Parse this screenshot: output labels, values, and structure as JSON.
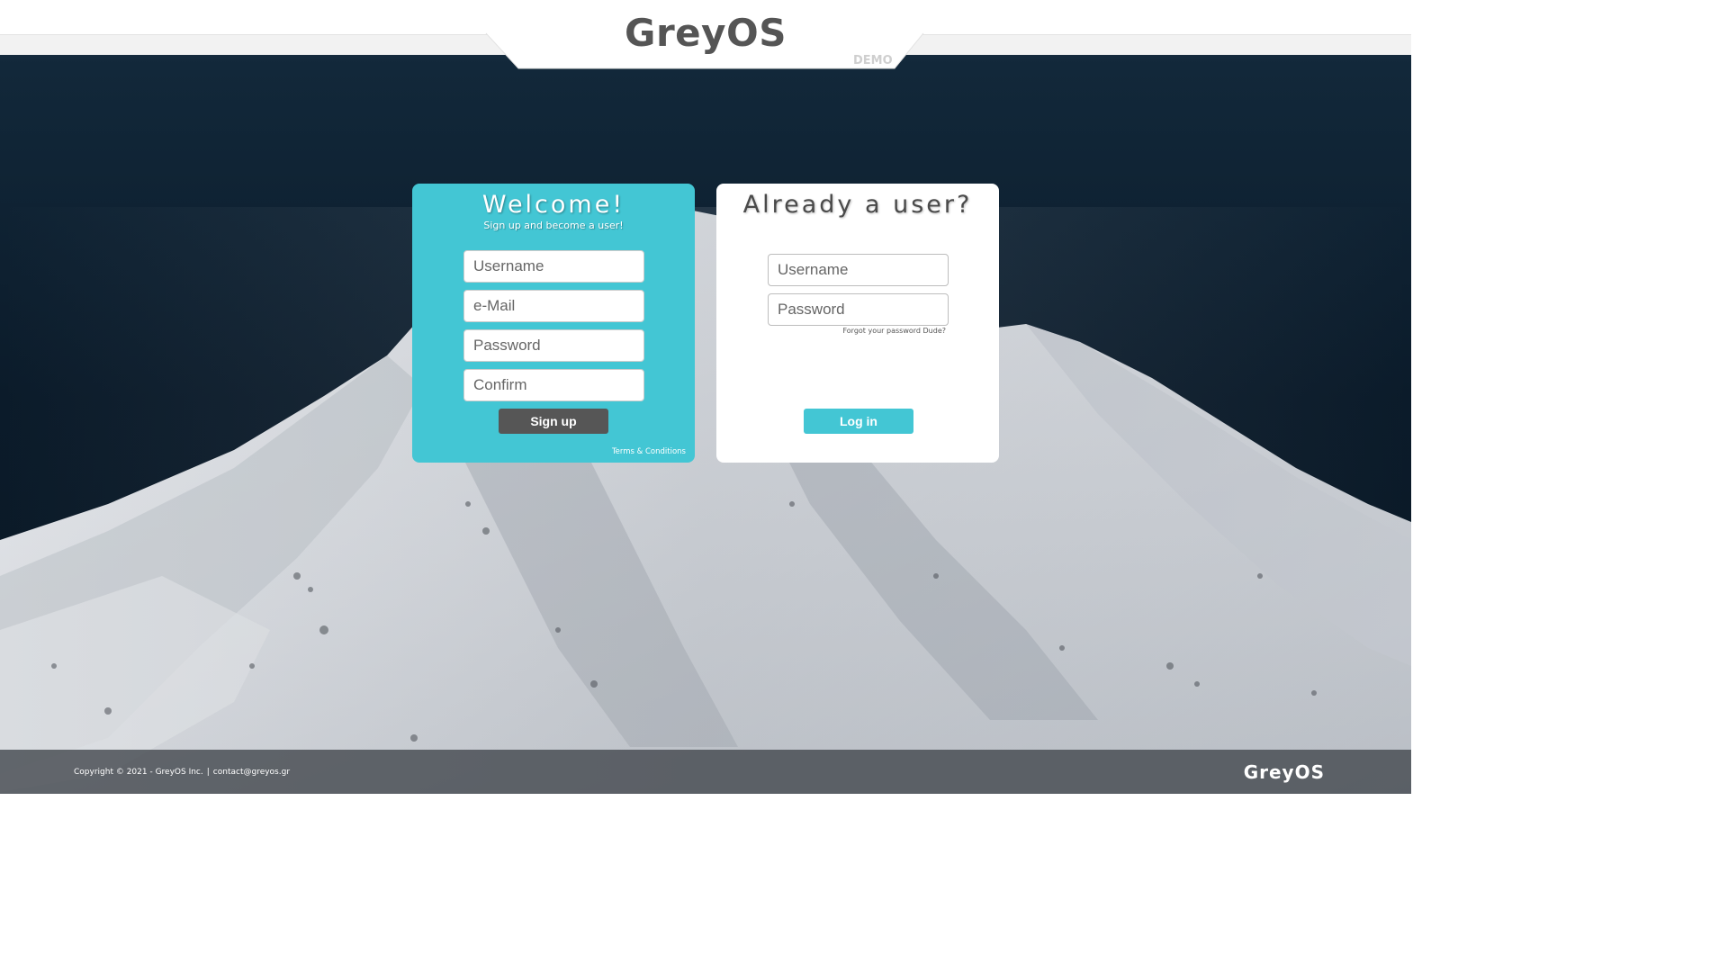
{
  "header": {
    "brand": "GreyOS",
    "tag": "DEMO"
  },
  "signup": {
    "title": "Welcome!",
    "subtitle": "Sign up and become a user!",
    "username_placeholder": "Username",
    "email_placeholder": "e-Mail",
    "password_placeholder": "Password",
    "confirm_placeholder": "Confirm",
    "button_label": "Sign up",
    "terms_label": "Terms & Conditions"
  },
  "login": {
    "title": "Already a user?",
    "username_placeholder": "Username",
    "password_placeholder": "Password",
    "forgot_label": "Forgot your password Dude?",
    "button_label": "Log in"
  },
  "footer": {
    "copyright": "Copyright © 2021 - GreyOS Inc.",
    "separator": "|",
    "email": "contact@greyos.gr",
    "brand": "GreyOS"
  },
  "colors": {
    "accent": "#43c6d4",
    "signup_button": "#565656",
    "sky": "#0d1d2c",
    "brand_text": "#555555"
  }
}
